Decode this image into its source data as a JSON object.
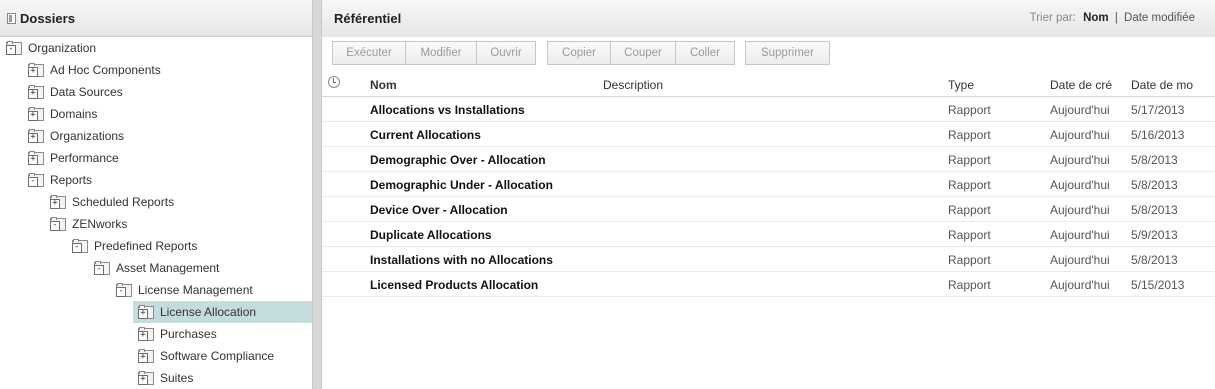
{
  "left": {
    "title": "Dossiers",
    "tree": [
      {
        "label": "Organization",
        "sign": "-",
        "level": 0
      },
      {
        "label": "Ad Hoc Components",
        "sign": "+",
        "level": 1
      },
      {
        "label": "Data Sources",
        "sign": "+",
        "level": 1
      },
      {
        "label": "Domains",
        "sign": "+",
        "level": 1
      },
      {
        "label": "Organizations",
        "sign": "+",
        "level": 1
      },
      {
        "label": "Performance",
        "sign": "+",
        "level": 1
      },
      {
        "label": "Reports",
        "sign": "-",
        "level": 1
      },
      {
        "label": "Scheduled Reports",
        "sign": "+",
        "level": 2
      },
      {
        "label": "ZENworks",
        "sign": "-",
        "level": 2
      },
      {
        "label": "Predefined Reports",
        "sign": "-",
        "level": 3
      },
      {
        "label": "Asset Management",
        "sign": "-",
        "level": 4
      },
      {
        "label": "License Management",
        "sign": "-",
        "level": 5
      },
      {
        "label": "License Allocation",
        "sign": "+",
        "level": 6,
        "selected": true
      },
      {
        "label": "Purchases",
        "sign": "+",
        "level": 6
      },
      {
        "label": "Software Compliance",
        "sign": "+",
        "level": 6
      },
      {
        "label": "Suites",
        "sign": "+",
        "level": 6
      }
    ]
  },
  "right": {
    "title": "Référentiel",
    "sort": {
      "label": "Trier par:",
      "active": "Nom",
      "sep": "|",
      "other": "Date modifiée"
    },
    "toolbar": {
      "group1": [
        "Exécuter",
        "Modifier",
        "Ouvrir"
      ],
      "group2": [
        "Copier",
        "Couper",
        "Coller"
      ],
      "group3": [
        "Supprimer"
      ]
    },
    "columns": {
      "name": "Nom",
      "description": "Description",
      "type": "Type",
      "created": "Date de cré",
      "modified": "Date de mo"
    },
    "rows": [
      {
        "name": "Allocations vs Installations",
        "type": "Rapport",
        "created": "Aujourd'hui",
        "modified": "5/17/2013"
      },
      {
        "name": "Current Allocations",
        "type": "Rapport",
        "created": "Aujourd'hui",
        "modified": "5/16/2013"
      },
      {
        "name": "Demographic Over - Allocation",
        "type": "Rapport",
        "created": "Aujourd'hui",
        "modified": "5/8/2013"
      },
      {
        "name": "Demographic Under - Allocation",
        "type": "Rapport",
        "created": "Aujourd'hui",
        "modified": "5/8/2013"
      },
      {
        "name": "Device Over - Allocation",
        "type": "Rapport",
        "created": "Aujourd'hui",
        "modified": "5/8/2013"
      },
      {
        "name": "Duplicate Allocations",
        "type": "Rapport",
        "created": "Aujourd'hui",
        "modified": "5/9/2013"
      },
      {
        "name": "Installations with no Allocations",
        "type": "Rapport",
        "created": "Aujourd'hui",
        "modified": "5/8/2013"
      },
      {
        "name": "Licensed Products Allocation",
        "type": "Rapport",
        "created": "Aujourd'hui",
        "modified": "5/15/2013"
      }
    ]
  }
}
